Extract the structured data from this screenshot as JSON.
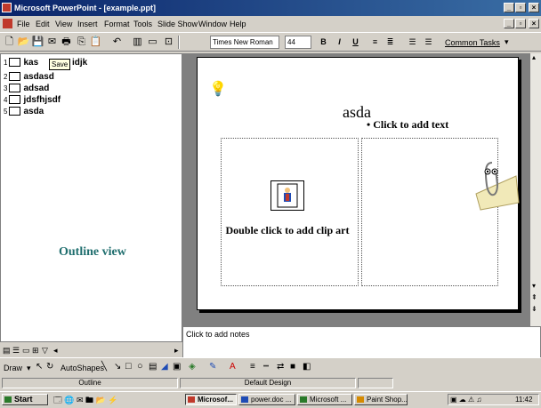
{
  "window": {
    "title": "Microsoft PowerPoint - [example.ppt]"
  },
  "menus": [
    "File",
    "Edit",
    "View",
    "Insert",
    "Format",
    "Tools",
    "Slide Show",
    "Window",
    "Help"
  ],
  "toolbar": {
    "font_name": "Times New Roman",
    "font_size": "44",
    "bold": "B",
    "italic": "I",
    "underline": "U",
    "common_tasks": "Common Tasks"
  },
  "outline": {
    "items": [
      {
        "num": "1",
        "text": "kas"
      },
      {
        "num": "2",
        "text": "asdasd"
      },
      {
        "num": "3",
        "text": "adsad"
      },
      {
        "num": "4",
        "text": "jdsfhjsdf"
      },
      {
        "num": "5",
        "text": "asda"
      }
    ],
    "item1_tail": "idjk",
    "tooltip": "Save",
    "label": "Outline view"
  },
  "slide": {
    "title": "asda",
    "clipart_prompt": "Double click to add clip art",
    "bullet_prompt": "Click to add text",
    "bullet_mark": "•"
  },
  "notes": {
    "placeholder": "Click to add notes"
  },
  "drawing": {
    "draw": "Draw",
    "autoshapes": "AutoShapes"
  },
  "status": {
    "view": "Outline",
    "design": "Default Design"
  },
  "taskbar": {
    "start": "Start",
    "tasks": [
      "Microsof...",
      "power.doc ...",
      "Microsoft ...",
      "Paint Shop..."
    ],
    "clock": "11:42"
  },
  "colors": {
    "titlebar_start": "#0a246a",
    "titlebar_end": "#3a6ea5",
    "outline_label": "#1f6e6e",
    "slide_area": "#808080"
  }
}
